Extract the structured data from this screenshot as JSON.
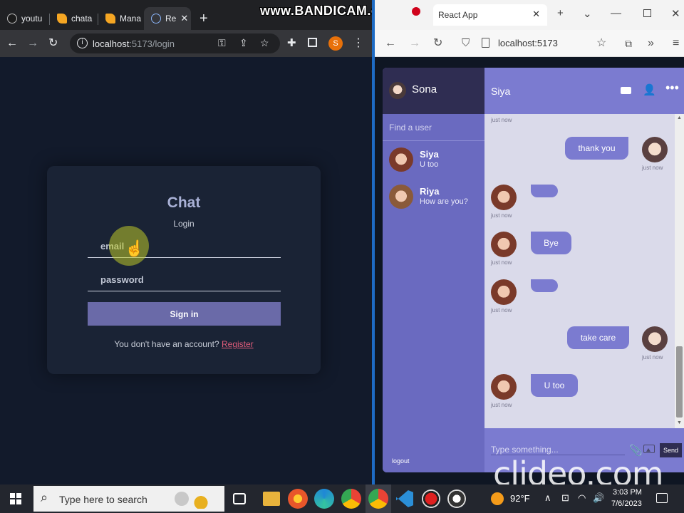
{
  "chrome": {
    "tabs": [
      {
        "label": "youtu",
        "favicon": "github-icon",
        "color": "#1b1b1b"
      },
      {
        "label": "chata",
        "favicon": "firebase-icon",
        "color": "#f5a623"
      },
      {
        "label": "Mana",
        "favicon": "firebase-icon",
        "color": "#f5a623"
      },
      {
        "label": "Re",
        "favicon": "globe-icon",
        "color": "#8ab4f8"
      }
    ],
    "url_host": "localhost",
    "url_path": ":5173/login",
    "profile_initial": "S",
    "recorder_watermark": "www.BANDICAM.com"
  },
  "login": {
    "title": "Chat",
    "subtitle": "Login",
    "email_placeholder": "email",
    "password_placeholder": "password",
    "signin_label": "Sign in",
    "footer_text": "You don't have an account?",
    "register_label": "Register"
  },
  "edge": {
    "tab_title": "React App",
    "url": "localhost:5173"
  },
  "chat": {
    "current_user": "Sona",
    "find_placeholder": "Find a user",
    "contacts": [
      {
        "name": "Siya",
        "last_message": "U too"
      },
      {
        "name": "Riya",
        "last_message": "How are you?"
      }
    ],
    "logout_label": "logout",
    "chat_with": "Siya",
    "messages": [
      {
        "owner": true,
        "text": "thank you",
        "time": "just now"
      },
      {
        "owner": false,
        "text": "",
        "time": "just now"
      },
      {
        "owner": false,
        "text": "Bye",
        "time": "just now"
      },
      {
        "owner": false,
        "text": "",
        "time": "just now"
      },
      {
        "owner": true,
        "text": "take care",
        "time": "just now"
      },
      {
        "owner": false,
        "text": "U too",
        "time": "just now"
      }
    ],
    "top_time": "just now",
    "input_placeholder": "Type something...",
    "send_label": "Send"
  },
  "video_watermark": "clideo.com",
  "taskbar": {
    "search_placeholder": "Type here to search",
    "temperature": "92°F",
    "time": "3:03 PM",
    "date": "7/6/2023"
  }
}
